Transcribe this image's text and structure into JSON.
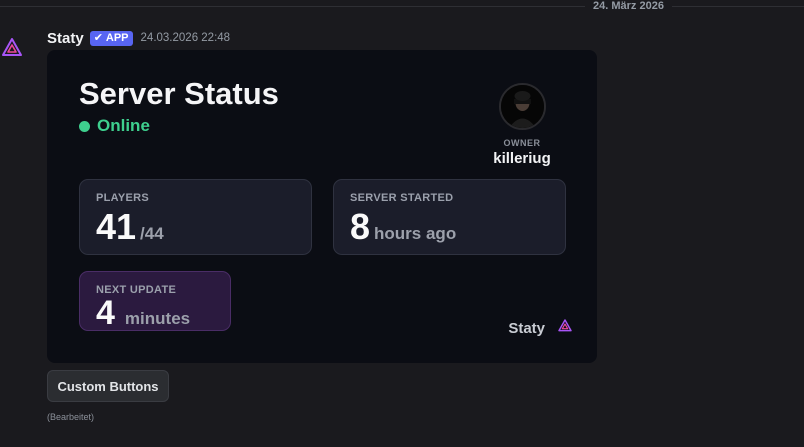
{
  "divider": {
    "date": "24. März 2026"
  },
  "message": {
    "username": "Staty",
    "badge": "APP",
    "timestamp": "24.03.2026 22:48",
    "edited": "(Bearbeitet)"
  },
  "card": {
    "title": "Server Status",
    "status": "Online",
    "owner_label": "OWNER",
    "owner_name": "killeriug",
    "players_label": "PLAYERS",
    "players_value": "41",
    "players_max": "/44",
    "started_label": "SERVER STARTED",
    "started_value": "8",
    "started_unit": "hours ago",
    "next_label": "NEXT UPDATE",
    "next_value": "4",
    "next_unit": "minutes",
    "brand": "Staty"
  },
  "buttons": {
    "custom": "Custom Buttons"
  },
  "colors": {
    "online": "#3ecf8e",
    "badge": "#5865f2",
    "brand_icon": "#8a5cf6"
  },
  "icons": {
    "bot_avatar": "staty-logo-icon",
    "badge_check": "check-icon",
    "footer": "staty-logo-icon"
  }
}
